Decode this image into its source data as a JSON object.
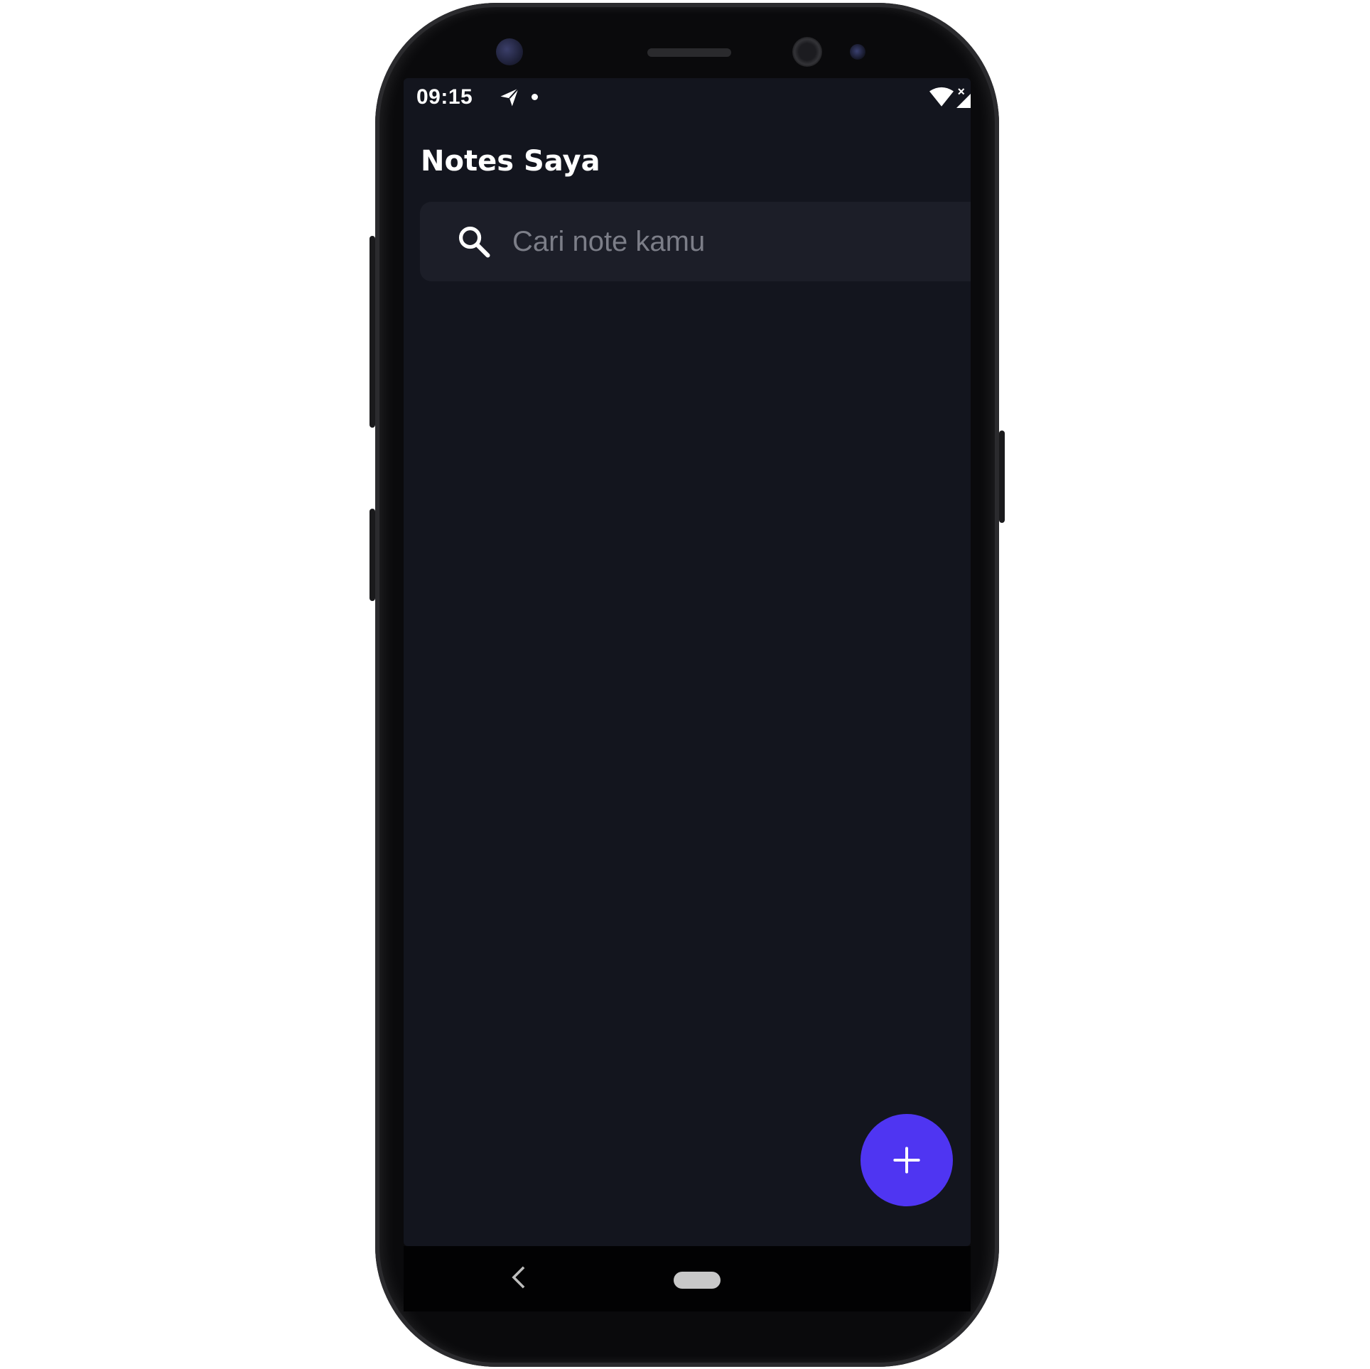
{
  "status_bar": {
    "time": "09:15",
    "icons": [
      "send-icon",
      "notification-dot",
      "wifi-icon",
      "signal-icon",
      "battery-icon"
    ]
  },
  "app": {
    "title": "Notes Saya"
  },
  "search": {
    "placeholder": "Cari note kamu",
    "value": "",
    "icon": "search-icon"
  },
  "fab": {
    "icon": "plus-icon",
    "color": "#4f35f2"
  },
  "nav": {
    "icons": [
      "back-icon",
      "home-pill"
    ]
  },
  "colors": {
    "background": "#13151e",
    "search_bg": "#1c1e28",
    "accent": "#4f35f2"
  }
}
